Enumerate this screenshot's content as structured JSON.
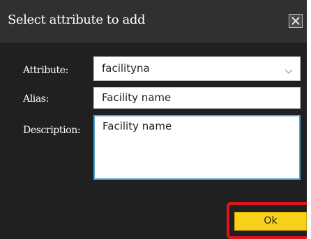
{
  "dialog": {
    "title": "Select attribute to add",
    "close_icon": "close-x-icon"
  },
  "form": {
    "attribute_label": "Attribute:",
    "attribute_value": "facilityna",
    "alias_label": "Alias:",
    "alias_value": "Facility name",
    "description_label": "Description:",
    "description_value": "Facility name"
  },
  "actions": {
    "ok_label": "Ok"
  },
  "colors": {
    "dialog_bg": "#202020",
    "titlebar_bg": "#303030",
    "ok_bg": "#f7d117",
    "highlight": "#e0141f",
    "focus_border": "#4aa3d4"
  }
}
